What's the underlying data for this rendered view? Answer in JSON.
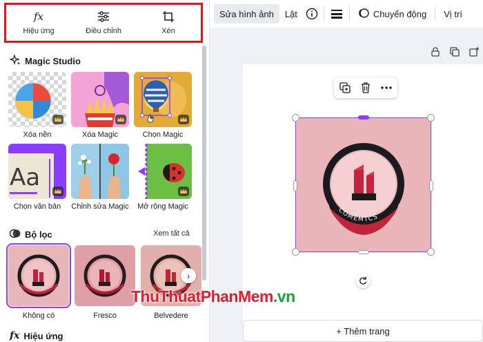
{
  "left_panel": {
    "tabs": [
      {
        "label": "Hiệu ứng",
        "icon": "fx-icon"
      },
      {
        "label": "Điều chỉnh",
        "icon": "sliders-icon"
      },
      {
        "label": "Xén",
        "icon": "crop-icon"
      }
    ],
    "magic_studio": {
      "title": "Magic Studio",
      "items": [
        {
          "label": "Xóa nền"
        },
        {
          "label": "Xóa Magic"
        },
        {
          "label": "Chọn Magic"
        },
        {
          "label": "Chọn văn bản"
        },
        {
          "label": "Chỉnh sửa Magic"
        },
        {
          "label": "Mở rộng Magic"
        }
      ]
    },
    "filters": {
      "title": "Bộ lọc",
      "see_all": "Xem tất cả",
      "items": [
        {
          "label": "Không có",
          "selected": true
        },
        {
          "label": "Fresco",
          "selected": false
        },
        {
          "label": "Belvedere",
          "selected": false
        }
      ]
    },
    "effects_section": {
      "title": "Hiệu ứng"
    }
  },
  "toolbar": {
    "edit_image": "Sửa hình ảnh",
    "flip": "Lật",
    "motion": "Chuyển động",
    "position": "Vị trí"
  },
  "canvas": {
    "add_page": "+ Thêm trang",
    "logo_text": "COMEMTCS"
  },
  "watermark": {
    "part1": "ThuThuat",
    "part2": "PhanMem",
    "part3": ".vn"
  },
  "colors": {
    "accent": "#8b3dff",
    "highlight_box": "#e8141c",
    "image_bg": "#e9b5b8",
    "lipstick": "#c1243b",
    "watermark_red": "#e31c2d",
    "watermark_green": "#1f9d3c"
  }
}
